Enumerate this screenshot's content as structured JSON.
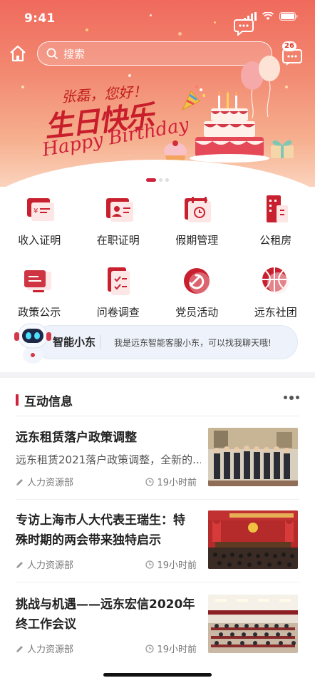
{
  "status_bar": {
    "time": "9:41"
  },
  "header": {
    "search_placeholder": "搜索",
    "message_badge": "26"
  },
  "banner": {
    "greeting": "张磊，您好！",
    "title_cn": "生日快乐",
    "title_en": "Happy Birthday",
    "active_slide": 1,
    "slide_count": 3
  },
  "quick_actions": [
    {
      "label": "收入证明",
      "icon": "income-certificate-icon"
    },
    {
      "label": "在职证明",
      "icon": "employment-certificate-icon"
    },
    {
      "label": "假期管理",
      "icon": "leave-management-icon"
    },
    {
      "label": "公租房",
      "icon": "public-housing-icon"
    },
    {
      "label": "政策公示",
      "icon": "policy-notice-icon"
    },
    {
      "label": "问卷调查",
      "icon": "survey-icon"
    },
    {
      "label": "党员活动",
      "icon": "party-activity-icon"
    },
    {
      "label": "远东社团",
      "icon": "club-icon"
    }
  ],
  "assistant": {
    "name": "智能小东",
    "tip": "我是远东智能客服小东，可以找我聊天哦!"
  },
  "section": {
    "title": "互动信息"
  },
  "news": [
    {
      "title": "远东租赁落户政策调整",
      "summary": "远东租赁2021落户政策调整，全新的...",
      "source": "人力资源部",
      "time": "19小时前"
    },
    {
      "title": "专访上海市人大代表王瑞生：特殊时期的两会带来独特启示",
      "source": "人力资源部",
      "time": "19小时前"
    },
    {
      "title": "挑战与机遇——远东宏信2020年终工作会议",
      "source": "人力资源部",
      "time": "19小时前"
    }
  ],
  "colors": {
    "brand": "#d0223a",
    "banner_top": "#f06a5c",
    "assistant_bg": "#eef3fb"
  }
}
